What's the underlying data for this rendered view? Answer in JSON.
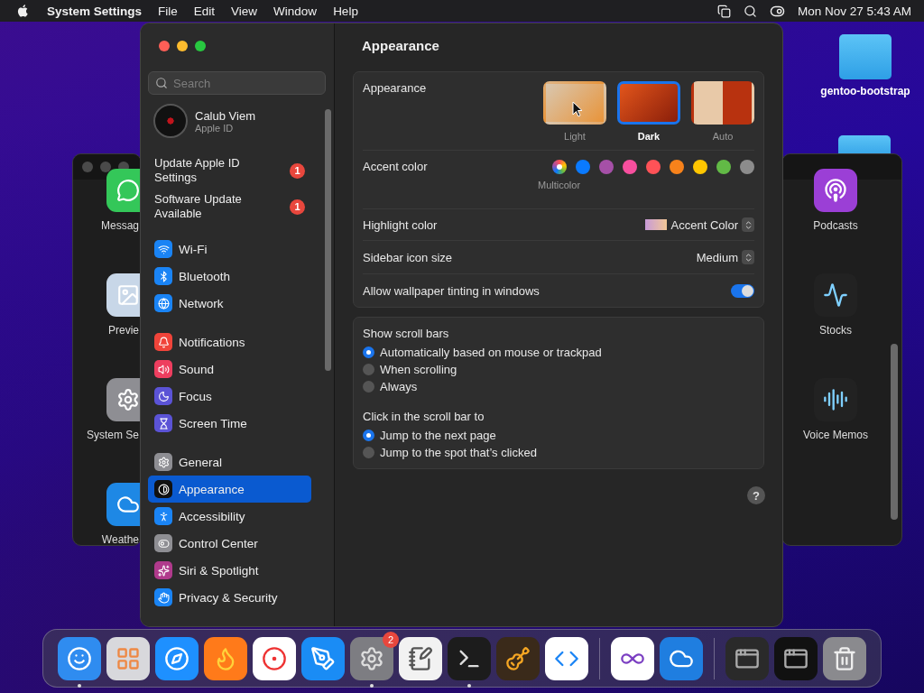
{
  "menu_bar": {
    "app": "System Settings",
    "menus": [
      "File",
      "Edit",
      "View",
      "Window",
      "Help"
    ],
    "clock": "Mon Nov 27  5:43 AM"
  },
  "desktop": {
    "folders": [
      {
        "label": "gentoo-bootstrap"
      }
    ]
  },
  "left_window": {
    "items": [
      "Messag",
      "Previe",
      "System Se",
      "Weathe"
    ]
  },
  "right_window": {
    "items": [
      "Podcasts",
      "Stocks",
      "Voice Memos"
    ]
  },
  "sidebar": {
    "search": {
      "placeholder": "Search"
    },
    "account": {
      "name": "Calub Viem",
      "subtitle": "Apple ID"
    },
    "alerts": [
      {
        "label": "Update Apple ID Settings",
        "badge": "1"
      },
      {
        "label": "Software Update Available",
        "badge": "1"
      }
    ],
    "groups": [
      {
        "items": [
          {
            "label": "Wi-Fi",
            "color": "#1a84f5",
            "selected": false
          },
          {
            "label": "Bluetooth",
            "color": "#1a84f5",
            "selected": false
          },
          {
            "label": "Network",
            "color": "#1a84f5",
            "selected": false
          }
        ]
      },
      {
        "items": [
          {
            "label": "Notifications",
            "color": "#f0443a",
            "selected": false
          },
          {
            "label": "Sound",
            "color": "#ee3e5f",
            "selected": false
          },
          {
            "label": "Focus",
            "color": "#5b53d6",
            "selected": false
          },
          {
            "label": "Screen Time",
            "color": "#5b53d6",
            "selected": false
          }
        ]
      },
      {
        "items": [
          {
            "label": "General",
            "color": "#8e8e93",
            "selected": false
          },
          {
            "label": "Appearance",
            "color": "#111111",
            "selected": true
          },
          {
            "label": "Accessibility",
            "color": "#1a84f5",
            "selected": false
          },
          {
            "label": "Control Center",
            "color": "#8e8e93",
            "selected": false
          },
          {
            "label": "Siri & Spotlight",
            "color": "#b03a8c",
            "selected": false
          },
          {
            "label": "Privacy & Security",
            "color": "#1a84f5",
            "selected": false
          }
        ]
      }
    ]
  },
  "content": {
    "title": "Appearance",
    "appearance": {
      "label": "Appearance",
      "options": [
        {
          "label": "Light",
          "selected": false
        },
        {
          "label": "Dark",
          "selected": true
        },
        {
          "label": "Auto",
          "selected": false
        }
      ]
    },
    "accent": {
      "label": "Accent color",
      "caption": "Multicolor",
      "colors": [
        {
          "kind": "multicolor",
          "selected": true
        },
        {
          "kind": "solid",
          "color": "#0a7aff",
          "selected": false
        },
        {
          "kind": "solid",
          "color": "#a550a7",
          "selected": false
        },
        {
          "kind": "solid",
          "color": "#f74f9e",
          "selected": false
        },
        {
          "kind": "solid",
          "color": "#ff5257",
          "selected": false
        },
        {
          "kind": "solid",
          "color": "#f7821b",
          "selected": false
        },
        {
          "kind": "solid",
          "color": "#ffc600",
          "selected": false
        },
        {
          "kind": "solid",
          "color": "#62ba46",
          "selected": false
        },
        {
          "kind": "solid",
          "color": "#8c8c8c",
          "selected": false
        }
      ]
    },
    "highlight": {
      "label": "Highlight color",
      "value": "Accent Color"
    },
    "icon_size": {
      "label": "Sidebar icon size",
      "value": "Medium"
    },
    "tinting": {
      "label": "Allow wallpaper tinting in windows",
      "on": true
    },
    "scroll_sections": [
      {
        "title": "Show scroll bars",
        "options": [
          {
            "label": "Automatically based on mouse or trackpad",
            "selected": true
          },
          {
            "label": "When scrolling",
            "selected": false
          },
          {
            "label": "Always",
            "selected": false
          }
        ]
      },
      {
        "title": "Click in the scroll bar to",
        "options": [
          {
            "label": "Jump to the next page",
            "selected": true
          },
          {
            "label": "Jump to the spot that’s clicked",
            "selected": false
          }
        ]
      }
    ],
    "help": "?"
  },
  "dock": {
    "sections": [
      {
        "items": [
          {
            "kind": "app",
            "color": "#2f8cf0",
            "running": true
          },
          {
            "kind": "app",
            "color": "#d8d8dc"
          },
          {
            "kind": "app",
            "color": "#1e90ff"
          },
          {
            "kind": "app",
            "color": "#ff7a1a"
          },
          {
            "kind": "app",
            "color": "#ffffff"
          },
          {
            "kind": "app",
            "color": "#1a8cf5"
          },
          {
            "kind": "app",
            "color": "#7d7d82",
            "running": true,
            "badge": "2"
          },
          {
            "kind": "app",
            "color": "#f2f2f2"
          },
          {
            "kind": "app",
            "color": "#1c1c1c",
            "running": true
          },
          {
            "kind": "app",
            "color": "#3a2a1a"
          },
          {
            "kind": "app",
            "color": "#ffffff"
          }
        ]
      },
      {
        "items": [
          {
            "kind": "app",
            "color": "#ffffff"
          },
          {
            "kind": "app",
            "color": "#1f7ee0"
          }
        ]
      },
      {
        "items": [
          {
            "kind": "window",
            "color": "#2a2a2a"
          },
          {
            "kind": "window",
            "color": "#111111"
          },
          {
            "kind": "trash",
            "color": "#8a8a8e"
          }
        ]
      }
    ]
  }
}
